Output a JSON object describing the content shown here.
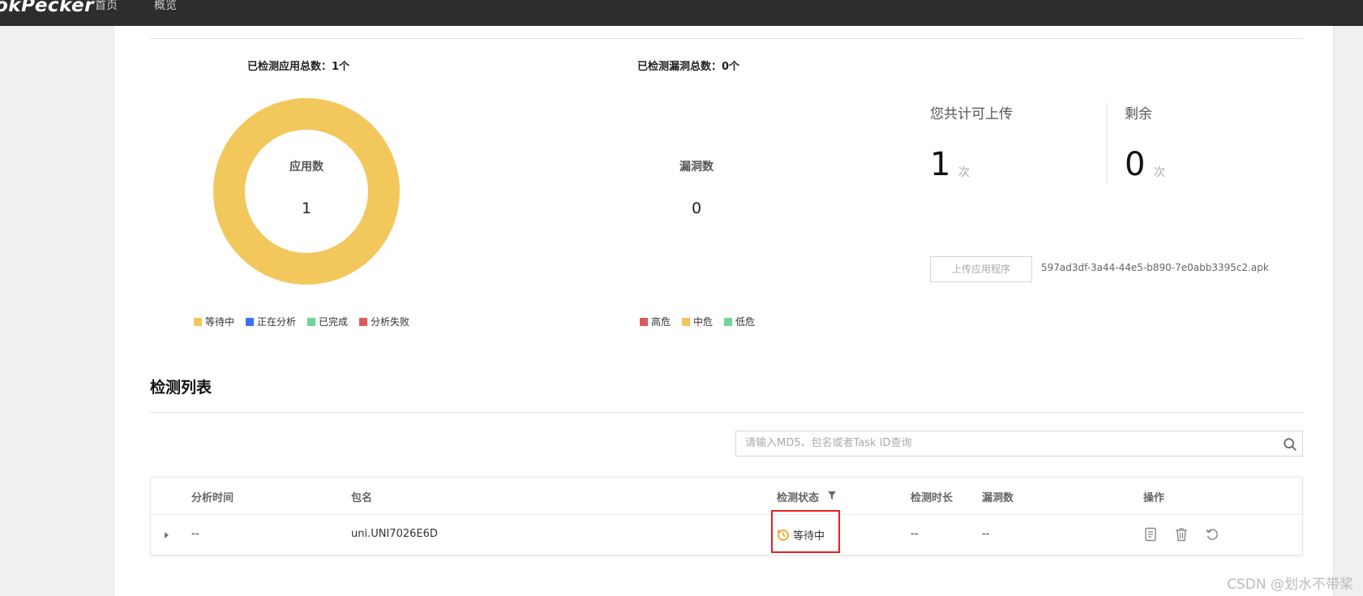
{
  "topbar": {
    "brand": "okPecker",
    "nav": [
      "首页",
      "概览"
    ],
    "color": "#2d2d2d"
  },
  "apps_stat": {
    "title": "已检测应用总数：1个",
    "center_label": "应用数",
    "center_value": "1",
    "legend": [
      {
        "label": "等待中",
        "color": "#f2c75c"
      },
      {
        "label": "正在分析",
        "color": "#3b74f0"
      },
      {
        "label": "已完成",
        "color": "#6fd39a"
      },
      {
        "label": "分析失败",
        "color": "#e05a5a"
      }
    ],
    "ring_color": "#f2c75c"
  },
  "vuln_stat": {
    "title": "已检测漏洞总数：0个",
    "center_label": "漏洞数",
    "center_value": "0",
    "legend": [
      {
        "label": "高危",
        "color": "#e05a5a"
      },
      {
        "label": "中危",
        "color": "#f2c75c"
      },
      {
        "label": "低危",
        "color": "#6fd39a"
      }
    ]
  },
  "quota": {
    "total_label": "您共计可上传",
    "total_value": "1",
    "remaining_label": "剩余",
    "remaining_value": "0",
    "unit": "次"
  },
  "upload": {
    "button_label": "上传应用程序",
    "file_name": "597ad3df-3a44-44e5-b890-7e0abb3395c2.apk"
  },
  "list": {
    "title": "检测列表",
    "search_placeholder": "请输入MD5、包名或者Task ID查询",
    "columns": [
      "分析时间",
      "包名",
      "检测状态",
      "检测时长",
      "漏洞数",
      "操作"
    ],
    "rows": [
      {
        "time": "--",
        "package": "uni.UNI7026E6D",
        "status": "等待中",
        "duration": "--",
        "vulns": "--"
      }
    ],
    "status_color": "#f5a623",
    "highlight_color": "#e82020"
  },
  "watermark": "CSDN @划水不带桨"
}
